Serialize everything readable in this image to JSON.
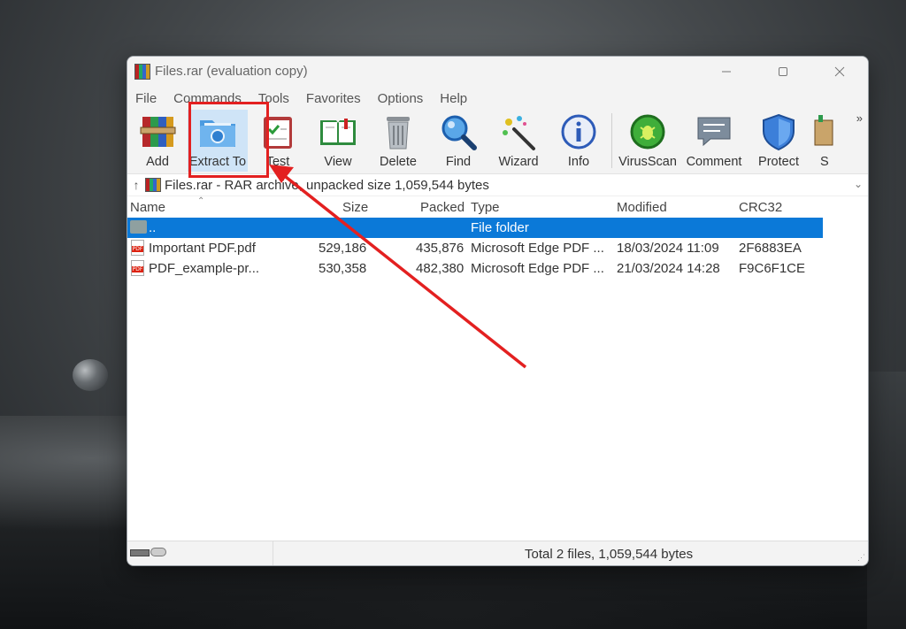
{
  "window": {
    "title": "Files.rar (evaluation copy)",
    "controls": {
      "minimize": "minimize-icon",
      "maximize": "maximize-icon",
      "close": "close-icon"
    }
  },
  "menu": [
    "File",
    "Commands",
    "Tools",
    "Favorites",
    "Options",
    "Help"
  ],
  "toolbar": {
    "tools": [
      {
        "label": "Add",
        "icon": "add-archive-icon"
      },
      {
        "label": "Extract To",
        "icon": "extract-folder-icon",
        "highlighted": true
      },
      {
        "label": "Test",
        "icon": "test-clipboard-icon"
      },
      {
        "label": "View",
        "icon": "view-book-icon"
      },
      {
        "label": "Delete",
        "icon": "trash-icon"
      },
      {
        "label": "Find",
        "icon": "magnifier-icon"
      },
      {
        "label": "Wizard",
        "icon": "magic-wand-icon"
      },
      {
        "label": "Info",
        "icon": "info-icon"
      }
    ],
    "tools_right": [
      {
        "label": "VirusScan",
        "icon": "virus-icon"
      },
      {
        "label": "Comment",
        "icon": "comment-icon"
      },
      {
        "label": "Protect",
        "icon": "shield-icon"
      },
      {
        "label": "S",
        "icon": "sfx-icon"
      }
    ],
    "overflow_glyph": "»"
  },
  "address": {
    "up_glyph": "↑",
    "text": "Files.rar - RAR archive, unpacked size 1,059,544 bytes",
    "dropdown_glyph": "⌄"
  },
  "columns": {
    "name": "Name",
    "size": "Size",
    "packed": "Packed",
    "type": "Type",
    "modified": "Modified",
    "crc": "CRC32",
    "sort_glyph": "⌃"
  },
  "rows": [
    {
      "name": "..",
      "size": "",
      "packed": "",
      "type": "File folder",
      "modified": "",
      "crc": "",
      "kind": "folder",
      "selected": true
    },
    {
      "name": "Important PDF.pdf",
      "size": "529,186",
      "packed": "435,876",
      "type": "Microsoft Edge PDF ...",
      "modified": "18/03/2024 11:09",
      "crc": "2F6883EA",
      "kind": "pdf",
      "selected": false
    },
    {
      "name": "PDF_example-pr...",
      "size": "530,358",
      "packed": "482,380",
      "type": "Microsoft Edge PDF ...",
      "modified": "21/03/2024 14:28",
      "crc": "F9C6F1CE",
      "kind": "pdf",
      "selected": false
    }
  ],
  "status": {
    "text": "Total 2 files, 1,059,544 bytes",
    "grip": "⋰"
  },
  "annotation": {
    "color": "#e32020",
    "pdf_badge": "PDF"
  }
}
